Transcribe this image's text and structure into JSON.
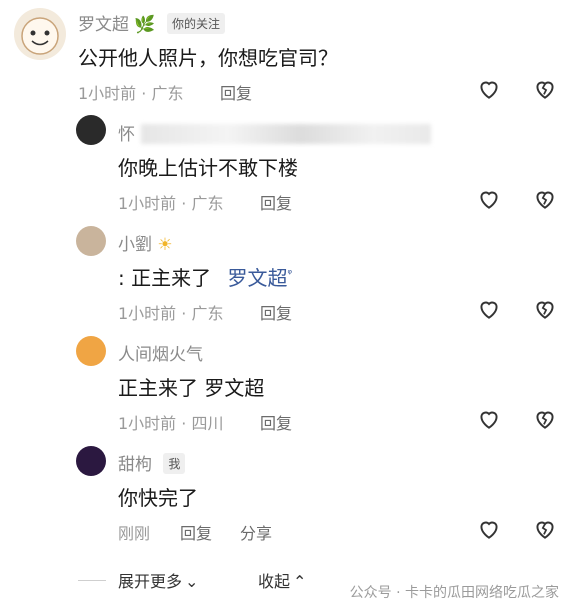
{
  "comments": [
    {
      "name": "罗文超",
      "badge": "你的关注",
      "text": "公开他人照片，你想吃官司？",
      "time": "1小时前 · 广东",
      "reply": "回复"
    },
    {
      "name": "怀",
      "text": "你晚上估计不敢下楼",
      "time": "1小时前 · 广东",
      "reply": "回复"
    },
    {
      "name": "小劉",
      "text": ": 正主来了",
      "mention": "罗文超",
      "time": "1小时前 · 广东",
      "reply": "回复"
    },
    {
      "name": "人间烟火气",
      "text": "正主来了  罗文超",
      "time": "1小时前 · 四川",
      "reply": "回复"
    },
    {
      "name": "甜枸",
      "badge": "我",
      "text": "你快完了",
      "time": "刚刚",
      "reply": "回复",
      "share": "分享"
    }
  ],
  "footer": {
    "expand": "展开更多",
    "collapse": "收起"
  },
  "watermark": "公众号 · 卡卡的瓜田网络吃瓜之家",
  "colors": {
    "meta": "#9a9a9a",
    "mention": "#3a5a9a",
    "badge_bg": "#efefef"
  }
}
